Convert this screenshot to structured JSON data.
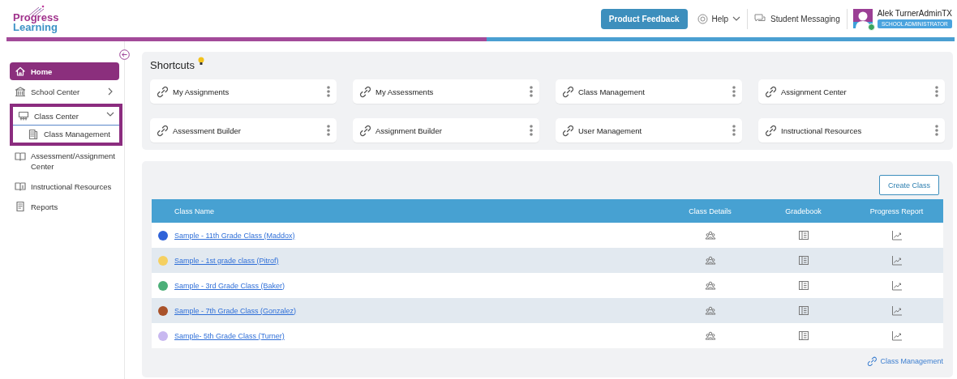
{
  "header": {
    "logo": {
      "line1": "Progress",
      "line2": "Learning"
    },
    "feedback_button": "Product Feedback",
    "help": "Help",
    "messaging": "Student Messaging",
    "user": {
      "name": "Alek TurnerAdminTX",
      "role": "SCHOOL ADMINISTRATOR",
      "online": true
    }
  },
  "sidebar": {
    "items": [
      {
        "label": "Home",
        "selected": true
      },
      {
        "label": "School Center",
        "selected": false,
        "expanded": false
      },
      {
        "label": "Class Center",
        "selected": false,
        "expanded": true,
        "highlighted": true,
        "children": [
          {
            "label": "Class Management",
            "selected": false
          }
        ]
      },
      {
        "label": "Assessment/Assignment Center",
        "selected": false
      },
      {
        "label": "Instructional Resources",
        "selected": false
      },
      {
        "label": "Reports",
        "selected": false
      }
    ]
  },
  "shortcuts": {
    "title": "Shortcuts",
    "items": [
      "My Assignments",
      "My Assessments",
      "Class Management",
      "Assignment Center",
      "Assessment Builder",
      "Assignment Builder",
      "User Management",
      "Instructional Resources"
    ]
  },
  "classes": {
    "create_button": "Create Class",
    "columns": [
      "Class Name",
      "Class Details",
      "Gradebook",
      "Progress Report"
    ],
    "rows": [
      {
        "name": "Sample - 11th Grade Class (Maddox)",
        "color": "#2f62d8"
      },
      {
        "name": "Sample - 1st grade class (Pitrof)",
        "color": "#f5d061"
      },
      {
        "name": "Sample - 3rd Grade Class (Baker)",
        "color": "#4caf78"
      },
      {
        "name": "Sample - 7th Grade Class (Gonzalez)",
        "color": "#a9522a"
      },
      {
        "name": "Sample- 5th Grade Class (Turner)",
        "color": "#c8b8f0"
      }
    ],
    "footer_link": "Class Management"
  }
}
